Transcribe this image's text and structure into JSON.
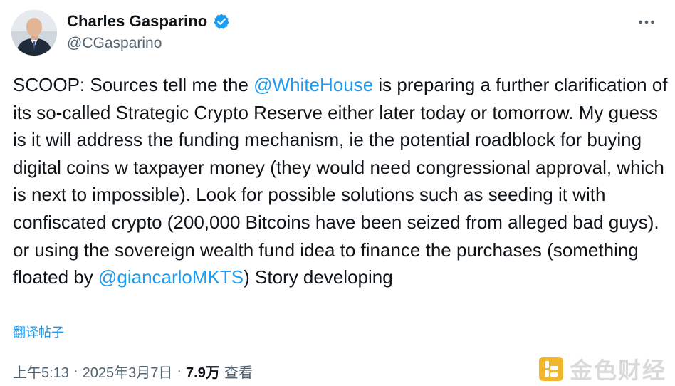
{
  "author": {
    "display_name": "Charles Gasparino",
    "handle": "@CGasparino",
    "verified_color": "#1d9bf0"
  },
  "tweet": {
    "segments": [
      {
        "type": "text",
        "text": "SCOOP: Sources tell me the "
      },
      {
        "type": "mention",
        "text": "@WhiteHouse"
      },
      {
        "type": "text",
        "text": " is preparing a further clarification of its so-called Strategic Crypto Reserve either later today or tomorrow. My guess is it will address the funding mechanism, ie the potential roadblock for buying digital coins w taxpayer money (they would need congressional approval, which is next to impossible). Look for possible solutions such as seeding it with confiscated crypto (200,000 Bitcoins have been seized from alleged bad guys). or using the sovereign wealth fund idea to finance the purchases (something floated by "
      },
      {
        "type": "mention",
        "text": "@giancarloMKTS"
      },
      {
        "type": "text",
        "text": ") Story developing"
      }
    ],
    "translate_label": "翻译帖子"
  },
  "meta": {
    "time": "上午5:13",
    "separator": "·",
    "date": "2025年3月7日",
    "views_count": "7.9万",
    "views_label": "查看"
  },
  "watermark": {
    "text": "金色财经"
  },
  "icons": {
    "more": "more-horizontal-icon",
    "verified": "verified-badge-icon",
    "watermark_logo": "jinse-logo-icon"
  },
  "colors": {
    "text": "#0f1419",
    "secondary": "#536471",
    "accent": "#1d9bf0"
  }
}
